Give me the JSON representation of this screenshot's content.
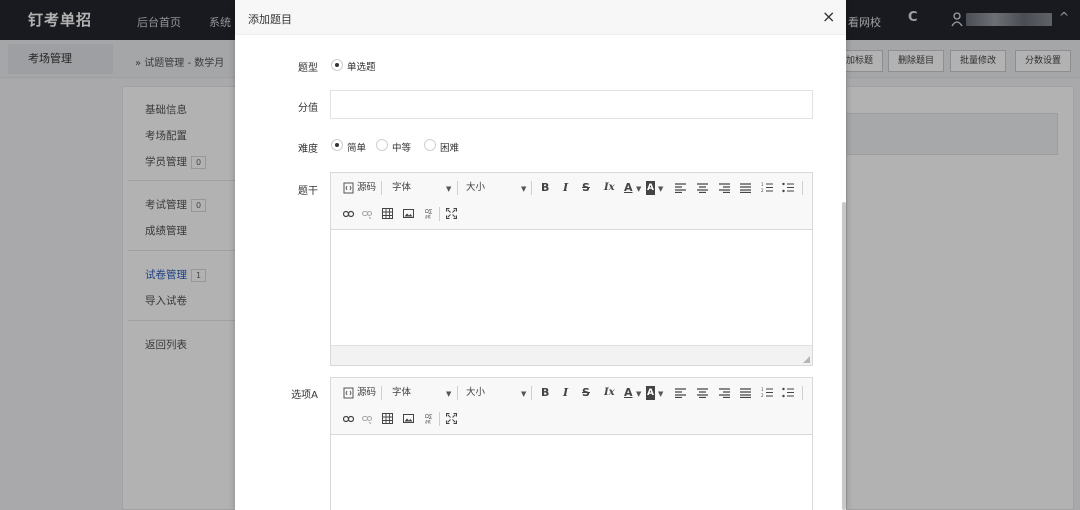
{
  "nav": {
    "logo": "钉考单招",
    "items": [
      "后台首页",
      "系统"
    ],
    "right_item": "看网校",
    "refresh_glyph": "C",
    "caret_glyph": "^"
  },
  "subbar": {
    "side_title": "考场管理",
    "breadcrumb": "» 试题管理 - 数学月",
    "buttons": [
      "加标题",
      "删除题目",
      "批量修改",
      "分数设置"
    ]
  },
  "sidebar": {
    "items": [
      {
        "label": "基础信息",
        "badge": ""
      },
      {
        "label": "考场配置",
        "badge": ""
      },
      {
        "label": "学员管理",
        "badge": "0"
      },
      {
        "label": "考试管理",
        "badge": "0"
      },
      {
        "label": "成绩管理",
        "badge": ""
      },
      {
        "label": "试卷管理",
        "badge": "1"
      },
      {
        "label": "导入试卷",
        "badge": ""
      },
      {
        "label": "返回列表",
        "badge": ""
      }
    ]
  },
  "modal": {
    "title": "添加题目",
    "close_glyph": "×",
    "fields": {
      "type_label": "题型",
      "type_option": "单选题",
      "score_label": "分值",
      "score_value": "",
      "difficulty_label": "难度",
      "difficulty_options": [
        "简单",
        "中等",
        "困难"
      ],
      "stem_label": "题干",
      "option_a_label": "选项A"
    },
    "editor_toolbar": {
      "source": "源码",
      "font": "字体",
      "size": "大小",
      "bold": "B",
      "italic": "I",
      "strike": "S",
      "clear_format": "Ix",
      "font_color": "A",
      "bg_color": "A"
    }
  }
}
